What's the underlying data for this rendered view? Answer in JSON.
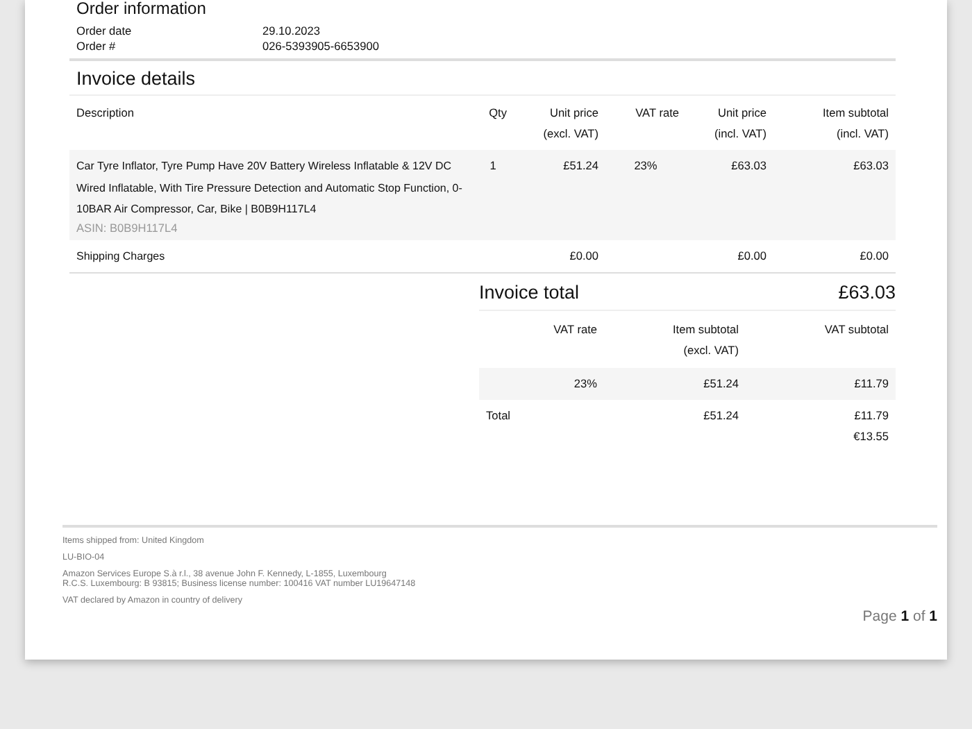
{
  "order_information": {
    "title": "Order information",
    "fields": [
      {
        "label": "Order date",
        "value": "29.10.2023"
      },
      {
        "label": "Order #",
        "value": "026-5393905-6653900"
      }
    ]
  },
  "invoice_details": {
    "title": "Invoice details",
    "columns": [
      "Description",
      "Qty",
      "Unit price\n(excl. VAT)",
      "VAT rate",
      "Unit price\n(incl. VAT)",
      "Item subtotal\n(incl. VAT)"
    ],
    "rows": [
      {
        "kind": "item",
        "description": "Car Tyre Inflator, Tyre Pump Have 20V Battery Wireless Inflatable & 12V DC Wired Inflatable, With Tire Pressure Detection and Automatic Stop Function, 0-10BAR Air Compressor, Car, Bike | B0B9H117L4",
        "asin": "ASIN: B0B9H117L4",
        "qty": "1",
        "unit_excl": "£51.24",
        "vat_rate": "23%",
        "unit_incl": "£63.03",
        "subtotal": "£63.03"
      },
      {
        "kind": "shipping",
        "description": "Shipping Charges",
        "unit_excl": "£0.00",
        "unit_incl": "£0.00",
        "subtotal": "£0.00"
      }
    ]
  },
  "invoice_total": {
    "label": "Invoice total",
    "value": "£63.03",
    "columns": [
      "VAT rate",
      "Item subtotal\n(excl. VAT)",
      "VAT subtotal"
    ],
    "rows": [
      {
        "cells": [
          [
            "23%"
          ],
          [
            "£51.24"
          ],
          [
            "£11.79"
          ]
        ]
      },
      {
        "cells": [
          [
            "Total"
          ],
          [
            "£51.24"
          ],
          [
            "£11.79",
            "€13.55"
          ]
        ]
      }
    ]
  },
  "footer": {
    "lines": [
      "Items shipped from: United Kingdom",
      "LU-BIO-04",
      "Amazon Services Europe S.à r.l., 38 avenue John F. Kennedy, L-1855, Luxembourg\nR.C.S. Luxembourg: B 93815; Business license number: 100416 VAT number LU19647148",
      "VAT declared by Amazon in country of delivery"
    ],
    "page": "Page **1** of **1**"
  }
}
